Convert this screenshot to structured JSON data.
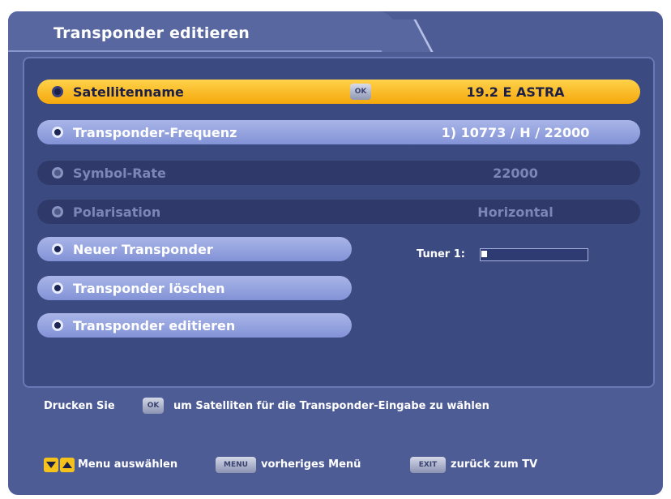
{
  "header": {
    "title": "Transponder editieren"
  },
  "rows": [
    {
      "label": "Satellitenname",
      "value": "19.2 E ASTRA",
      "ok_key": "OK",
      "state": "focused"
    },
    {
      "label": "Transponder-Frequenz",
      "value": "1) 10773 / H / 22000",
      "state": "normal"
    },
    {
      "label": "Symbol-Rate",
      "value": "22000",
      "state": "disabled"
    },
    {
      "label": "Polarisation",
      "value": "Horizontal",
      "state": "disabled"
    }
  ],
  "actions": [
    {
      "label": "Neuer Transponder"
    },
    {
      "label": "Transponder löschen"
    },
    {
      "label": "Transponder editieren"
    }
  ],
  "tuner": {
    "label": "Tuner 1:",
    "signal_fraction": 0.05
  },
  "hint": {
    "prefix": "Drucken Sie",
    "ok_key": "OK",
    "suffix": "um Satelliten für die Transponder-Eingabe zu wählen"
  },
  "footer": {
    "menu_select_label": "Menu auswählen",
    "menu_key": "MENU",
    "prev_menu_label": "vorheriges Menü",
    "exit_key": "EXIT",
    "back_tv_label": "zurück zum TV"
  },
  "colors": {
    "accent": "#f5a80d",
    "background": "#4e5c96",
    "panel": "#3c4a82"
  }
}
